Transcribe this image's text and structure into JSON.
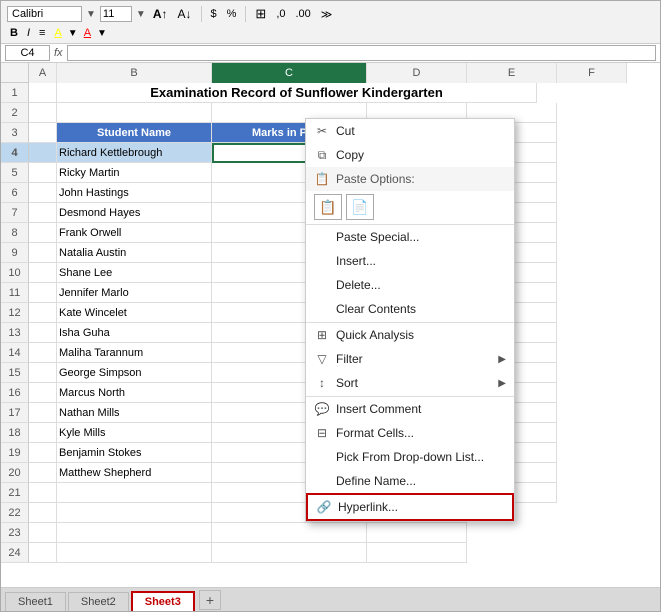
{
  "title": "Examination Record of Sunflower Kindergarten",
  "toolbar": {
    "font_name": "Calibri",
    "font_size": "11",
    "bold_label": "B",
    "italic_label": "I",
    "align_label": "≡",
    "font_color_label": "A",
    "border_label": "⊞",
    "percent_label": "%",
    "dollar_label": "$",
    "increase_decimal": ".0",
    "decrease_decimal": ".00"
  },
  "cell_name": "C4",
  "columns": {
    "a": {
      "label": "A",
      "width": 28
    },
    "b": {
      "label": "B",
      "width": 155
    },
    "c": {
      "label": "C",
      "width": 155
    },
    "d": {
      "label": "D",
      "width": 100
    },
    "e": {
      "label": "E",
      "width": 90
    },
    "f": {
      "label": "F",
      "width": 70
    }
  },
  "headers": {
    "student_name": "Student Name",
    "marks_in_physics": "Marks in Phys"
  },
  "students": [
    {
      "row": 4,
      "name": "Richard Kettlebrough"
    },
    {
      "row": 5,
      "name": "Ricky Martin"
    },
    {
      "row": 6,
      "name": "John Hastings"
    },
    {
      "row": 7,
      "name": "Desmond Hayes"
    },
    {
      "row": 8,
      "name": "Frank Orwell"
    },
    {
      "row": 9,
      "name": "Natalia Austin"
    },
    {
      "row": 10,
      "name": "Shane Lee"
    },
    {
      "row": 11,
      "name": "Jennifer Marlo"
    },
    {
      "row": 12,
      "name": "Kate Wincelet"
    },
    {
      "row": 13,
      "name": "Isha Guha"
    },
    {
      "row": 14,
      "name": "Maliha Tarannum"
    },
    {
      "row": 15,
      "name": "George Simpson"
    },
    {
      "row": 16,
      "name": "Marcus North"
    },
    {
      "row": 17,
      "name": "Nathan Mills"
    },
    {
      "row": 18,
      "name": "Kyle Mills"
    },
    {
      "row": 19,
      "name": "Benjamin Stokes"
    },
    {
      "row": 20,
      "name": "Matthew Shepherd"
    }
  ],
  "context_menu": {
    "cut": "Cut",
    "copy": "Copy",
    "paste_options": "Paste Options:",
    "paste_special": "Paste Special...",
    "insert": "Insert...",
    "delete": "Delete...",
    "clear_contents": "Clear Contents",
    "quick_analysis": "Quick Analysis",
    "filter": "Filter",
    "sort": "Sort",
    "insert_comment": "Insert Comment",
    "format_cells": "Format Cells...",
    "pick_from_dropdown": "Pick From Drop-down List...",
    "define_name": "Define Name...",
    "hyperlink": "Hyperlink..."
  },
  "sheet_tabs": {
    "sheet1": "Sheet1",
    "sheet2": "Sheet2",
    "sheet3": "Sheet3",
    "active": "Sheet3"
  },
  "row_numbers": [
    1,
    2,
    3,
    4,
    5,
    6,
    7,
    8,
    9,
    10,
    11,
    12,
    13,
    14,
    15,
    16,
    17,
    18,
    19,
    20,
    21,
    22,
    23,
    24
  ]
}
